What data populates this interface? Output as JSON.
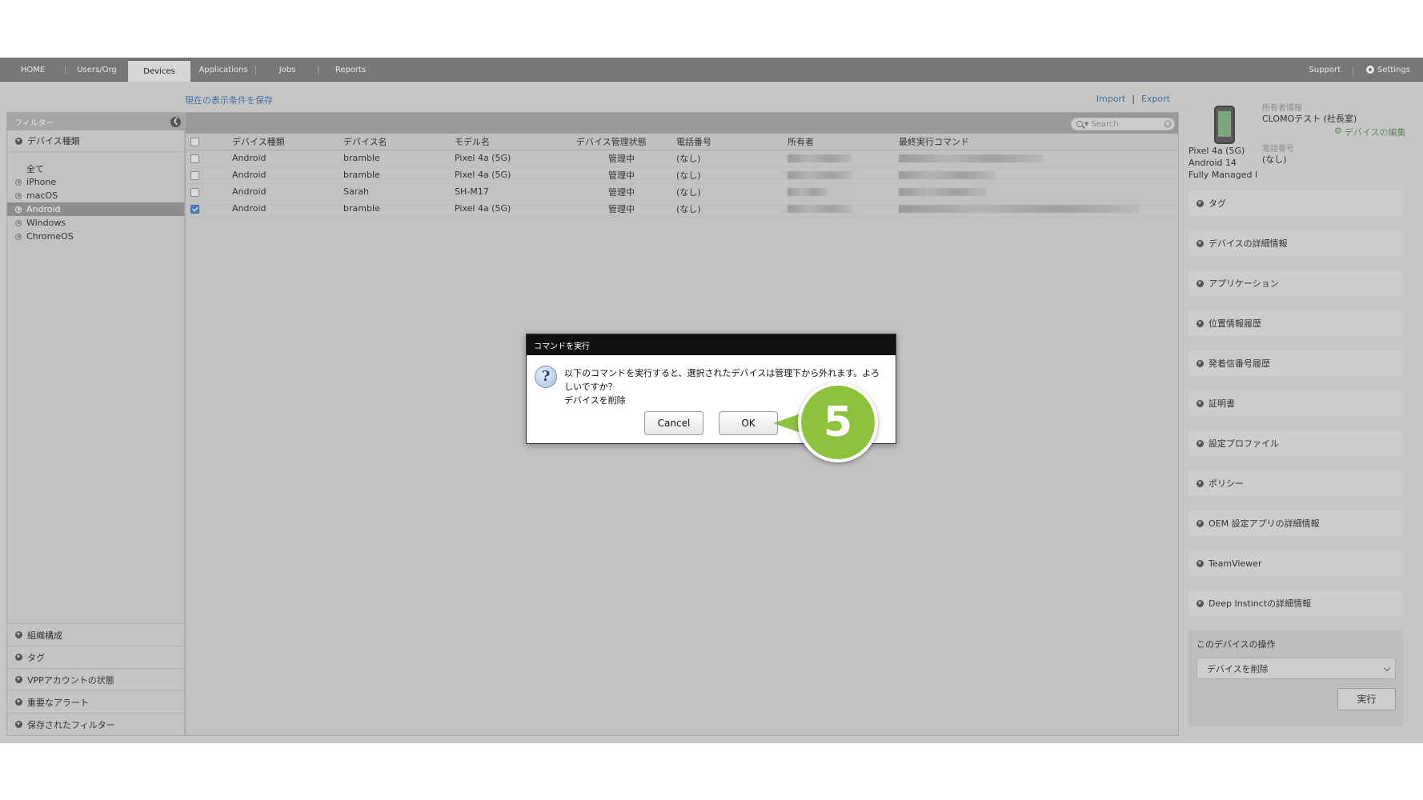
{
  "nav": {
    "tabs": [
      "HOME",
      "Users/Org",
      "Devices",
      "Applications",
      "Jobs",
      "Reports"
    ],
    "active_tab": "Devices",
    "support": "Support",
    "settings": "Settings"
  },
  "toolbar": {
    "save_view": "現在の表示条件を保存",
    "import": "Import",
    "separator": "|",
    "export": "Export"
  },
  "filter": {
    "title": "フィルター",
    "device_type_section": "デバイス種類",
    "device_types": [
      "全て",
      "iPhone",
      "macOS",
      "Android",
      "Windows",
      "ChromeOS"
    ],
    "selected": "Android",
    "bottom_sections": [
      "組織構成",
      "タグ",
      "VPPアカウントの状態",
      "重要なアラート",
      "保存されたフィルター"
    ]
  },
  "table": {
    "search_placeholder": "Search",
    "columns": [
      "デバイス種類",
      "デバイス名",
      "モデル名",
      "デバイス管理状態",
      "電話番号",
      "所有者",
      "最終実行コマンド"
    ],
    "rows": [
      {
        "type": "Android",
        "name": "bramble",
        "model": "Pixel 4a (5G)",
        "status": "管理中",
        "phone": "(なし)",
        "checked": false
      },
      {
        "type": "Android",
        "name": "bramble",
        "model": "Pixel 4a (5G)",
        "status": "管理中",
        "phone": "(なし)",
        "checked": false
      },
      {
        "type": "Android",
        "name": "Sarah",
        "model": "SH-M17",
        "status": "管理中",
        "phone": "(なし)",
        "checked": false
      },
      {
        "type": "Android",
        "name": "bramble",
        "model": "Pixel 4a (5G)",
        "status": "管理中",
        "phone": "(なし)",
        "checked": true
      }
    ]
  },
  "device_panel": {
    "owner_label": "所有者情報",
    "owner_value": "CLOMOテスト (社長室)",
    "edit_link": "デバイスの編集",
    "phone_label": "電話番号",
    "phone_value": "(なし)",
    "model": "Pixel 4a (5G)",
    "os": "Android 14",
    "mode": "Fully Managed I",
    "sections": [
      "タグ",
      "デバイスの詳細情報",
      "アプリケーション",
      "位置情報履歴",
      "発着信番号履歴",
      "証明書",
      "設定プロファイル",
      "ポリシー",
      "OEM 設定アプリの詳細情報",
      "TeamViewer",
      "Deep Instinctの詳細情報"
    ],
    "operations_title": "このデバイスの操作",
    "operation_selected": "デバイスを削除",
    "execute": "実行"
  },
  "dialog": {
    "title": "コマンドを実行",
    "message": "以下のコマンドを実行すると、選択されたデバイスは管理下から外れます。よろしいですか？",
    "command": "デバイスを削除",
    "cancel": "Cancel",
    "ok": "OK",
    "icon": "question-icon"
  },
  "callout": {
    "step": "5",
    "color": "#8dc23e"
  }
}
